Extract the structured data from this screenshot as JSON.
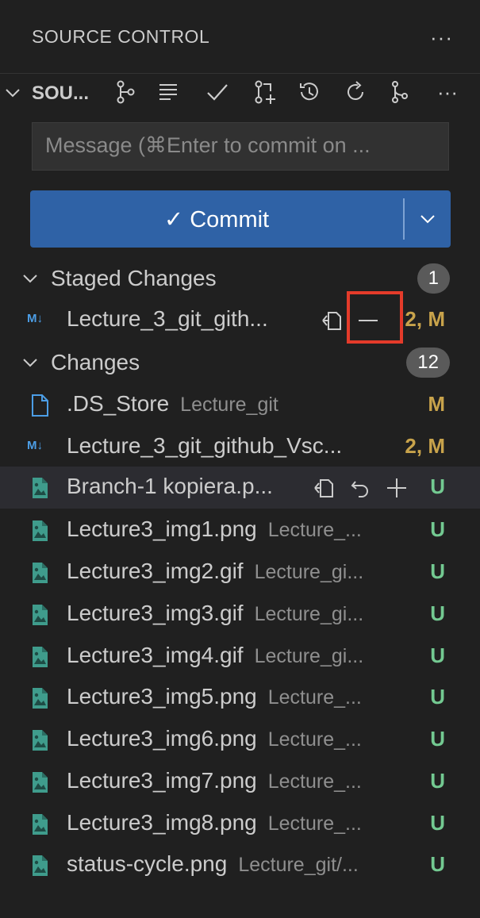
{
  "panel": {
    "title": "SOURCE CONTROL",
    "more_label": "···"
  },
  "section": {
    "name": "SOU...",
    "toolbar_icons": [
      "graph-icon",
      "list-icon",
      "check-icon",
      "pull-request-icon",
      "history-icon",
      "refresh-icon",
      "branch-icon",
      "more-icon"
    ],
    "more_label": "···"
  },
  "commit": {
    "placeholder": "Message (⌘Enter to commit on ...",
    "button_label": "✓ Commit"
  },
  "staged": {
    "label": "Staged Changes",
    "count": "1",
    "files": [
      {
        "name": "Lecture_3_git_gith...",
        "dir": "",
        "status": "2, M",
        "status_color": "#c8a34b",
        "icon": "markdown-icon"
      }
    ]
  },
  "changes": {
    "label": "Changes",
    "count": "12",
    "files": [
      {
        "name": ".DS_Store",
        "dir": "Lecture_git",
        "status": "M",
        "status_color": "#c8a34b",
        "icon": "file-icon"
      },
      {
        "name": "Lecture_3_git_github_Vsc...",
        "dir": "",
        "status": "2, M",
        "status_color": "#c8a34b",
        "icon": "markdown-icon"
      },
      {
        "name": "Branch-1 kopiera.p...",
        "dir": "",
        "status": "U",
        "status_color": "#73c991",
        "icon": "image-icon"
      },
      {
        "name": "Lecture3_img1.png",
        "dir": "Lecture_...",
        "status": "U",
        "status_color": "#73c991",
        "icon": "image-icon"
      },
      {
        "name": "Lecture3_img2.gif",
        "dir": "Lecture_gi...",
        "status": "U",
        "status_color": "#73c991",
        "icon": "image-icon"
      },
      {
        "name": "Lecture3_img3.gif",
        "dir": "Lecture_gi...",
        "status": "U",
        "status_color": "#73c991",
        "icon": "image-icon"
      },
      {
        "name": "Lecture3_img4.gif",
        "dir": "Lecture_gi...",
        "status": "U",
        "status_color": "#73c991",
        "icon": "image-icon"
      },
      {
        "name": "Lecture3_img5.png",
        "dir": "Lecture_...",
        "status": "U",
        "status_color": "#73c991",
        "icon": "image-icon"
      },
      {
        "name": "Lecture3_img6.png",
        "dir": "Lecture_...",
        "status": "U",
        "status_color": "#73c991",
        "icon": "image-icon"
      },
      {
        "name": "Lecture3_img7.png",
        "dir": "Lecture_...",
        "status": "U",
        "status_color": "#73c991",
        "icon": "image-icon"
      },
      {
        "name": "Lecture3_img8.png",
        "dir": "Lecture_...",
        "status": "U",
        "status_color": "#73c991",
        "icon": "image-icon"
      },
      {
        "name": "status-cycle.png",
        "dir": "Lecture_git/...",
        "status": "U",
        "status_color": "#73c991",
        "icon": "image-icon"
      }
    ]
  },
  "colors": {
    "background": "#202020",
    "accent_button": "#2f62a6",
    "modified": "#c8a34b",
    "untracked": "#73c991",
    "highlight": "#e43b2a"
  }
}
